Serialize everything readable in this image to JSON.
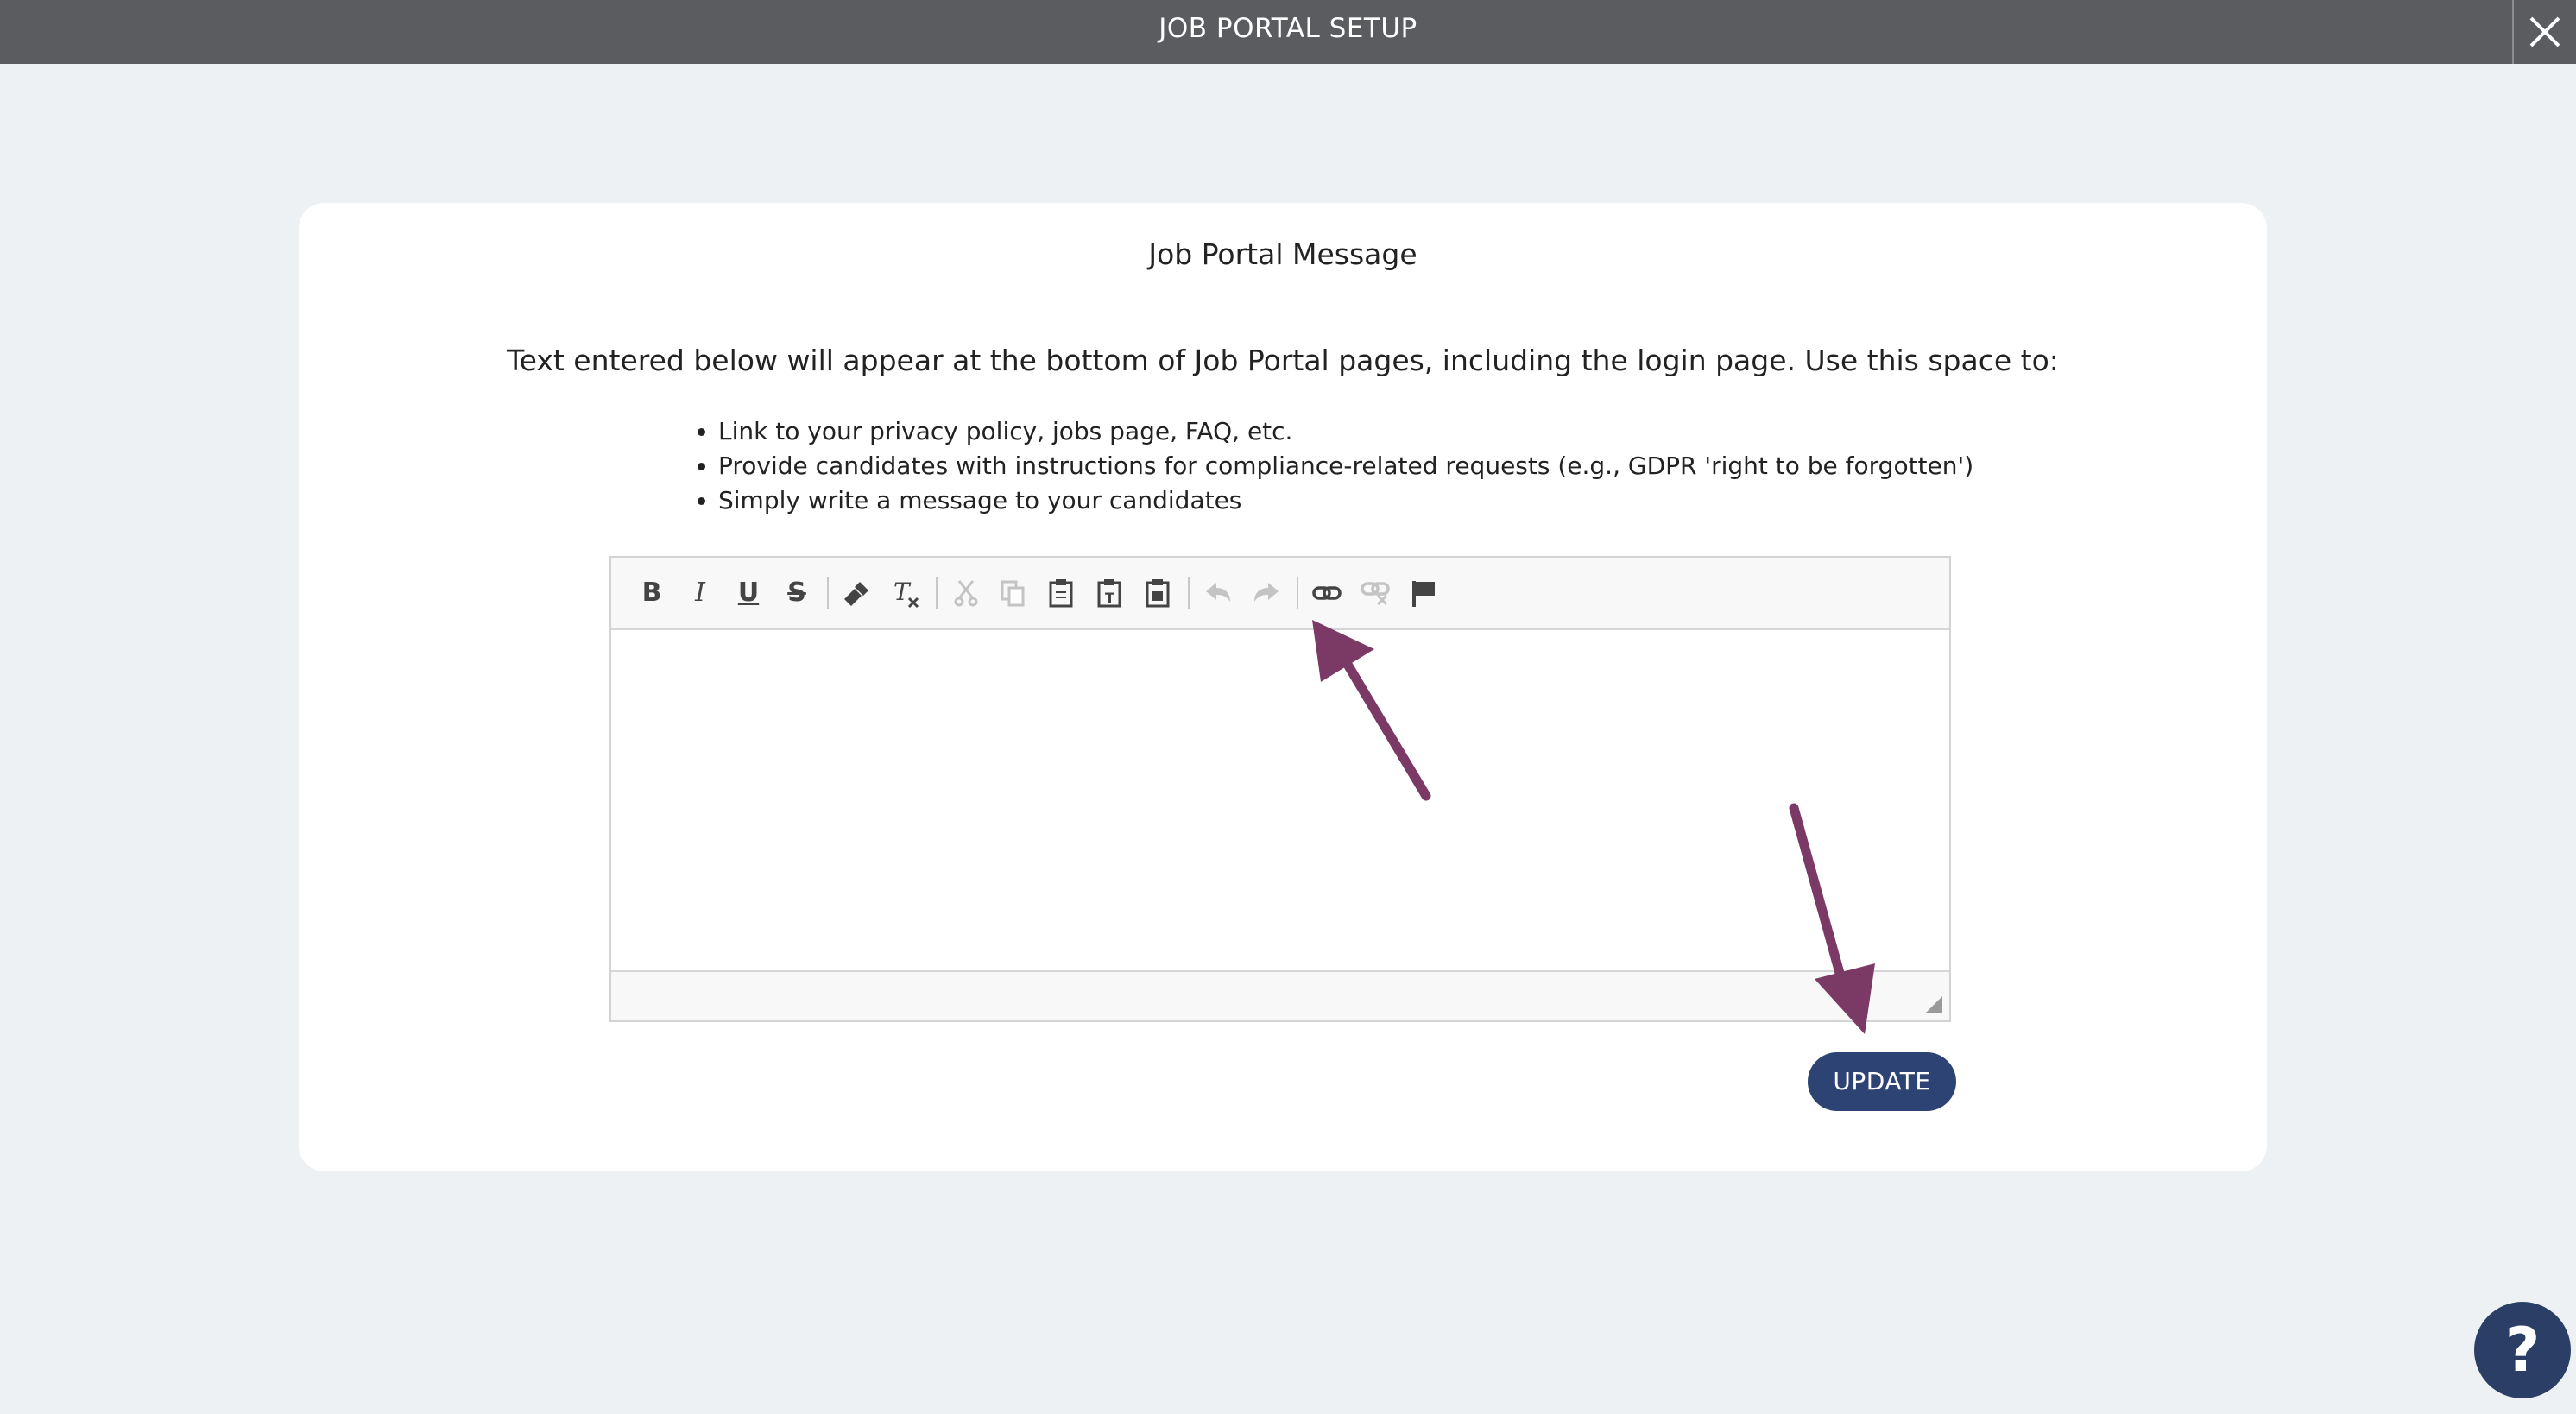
{
  "header": {
    "title": "JOB PORTAL SETUP",
    "close_icon": "close-icon"
  },
  "card": {
    "title": "Job Portal Message",
    "intro": "Text entered below will appear at the bottom of Job Portal pages, including the login page. Use this space to:",
    "bullets": [
      "Link to your privacy policy, jobs page, FAQ, etc.",
      "Provide candidates with instructions for compliance-related requests (e.g., GDPR 'right to be forgotten')",
      "Simply write a message to your candidates"
    ]
  },
  "editor": {
    "toolbar": {
      "bold_label": "B",
      "italic_label": "I",
      "underline_label": "U",
      "strike_label": "S",
      "tools": [
        "bold-icon",
        "italic-icon",
        "underline-icon",
        "strikethrough-icon",
        "format-painter-icon",
        "clear-format-icon",
        "cut-icon",
        "copy-icon",
        "paste-icon",
        "paste-text-icon",
        "paste-word-icon",
        "undo-icon",
        "redo-icon",
        "link-icon",
        "unlink-icon",
        "anchor-flag-icon"
      ]
    },
    "content": ""
  },
  "actions": {
    "update_label": "UPDATE"
  },
  "help": {
    "label": "?"
  },
  "colors": {
    "topbar": "#5a5c60",
    "background": "#eef1f4",
    "button": "#2d4373",
    "arrow": "#7b3a66",
    "help": "#2b3f66"
  }
}
